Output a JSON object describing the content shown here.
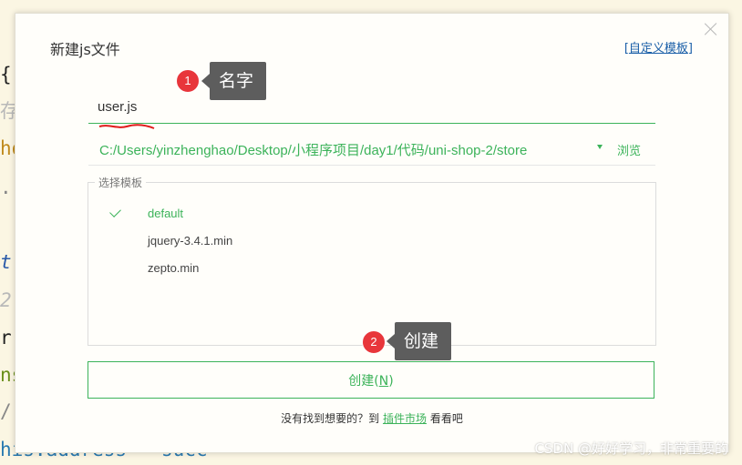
{
  "background_code": [
    {
      "text": "{",
      "color": "#222222"
    },
    {
      "text": "存",
      "color": "#b9b9b9"
    },
    {
      "text": "ho",
      "color": "#c08a1c"
    },
    {
      "text": ".",
      "color": "#888888"
    },
    {
      "text": "t",
      "color": "#2a5aa8"
    },
    {
      "text": "2.",
      "color": "#b9b9b9"
    },
    {
      "text": "rr",
      "color": "#222222"
    },
    {
      "text": "ns",
      "color": "#6a8f1a"
    },
    {
      "text": "/",
      "color": "#888888"
    },
    {
      "text": "his.address = succ",
      "color": "#2a7ab0"
    }
  ],
  "dialog": {
    "title": "新建js文件",
    "custom_template_link": "自定义模板",
    "name_value": "user.js",
    "path": "C:/Users/yinzhenghao/Desktop/小程序项目/day1/代码/uni-shop-2/store",
    "browse_label": "浏览",
    "template_group_label": "选择模板",
    "templates": [
      {
        "label": "default",
        "selected": true
      },
      {
        "label": "jquery-3.4.1.min",
        "selected": false
      },
      {
        "label": "zepto.min",
        "selected": false
      }
    ],
    "create_button": {
      "label": "创建",
      "shortcut": "N"
    },
    "footer": {
      "prefix": "没有找到想要的？到",
      "link": "插件市场",
      "suffix": "看看吧"
    }
  },
  "annotations": [
    {
      "number": "1",
      "text": "名字"
    },
    {
      "number": "2",
      "text": "创建"
    }
  ],
  "watermark": "CSDN @好好学习，非常重要的",
  "colors": {
    "accent": "#3cb35a",
    "badge": "#e8363b",
    "callout": "#5d5d5d",
    "link": "#1a5fa8"
  }
}
